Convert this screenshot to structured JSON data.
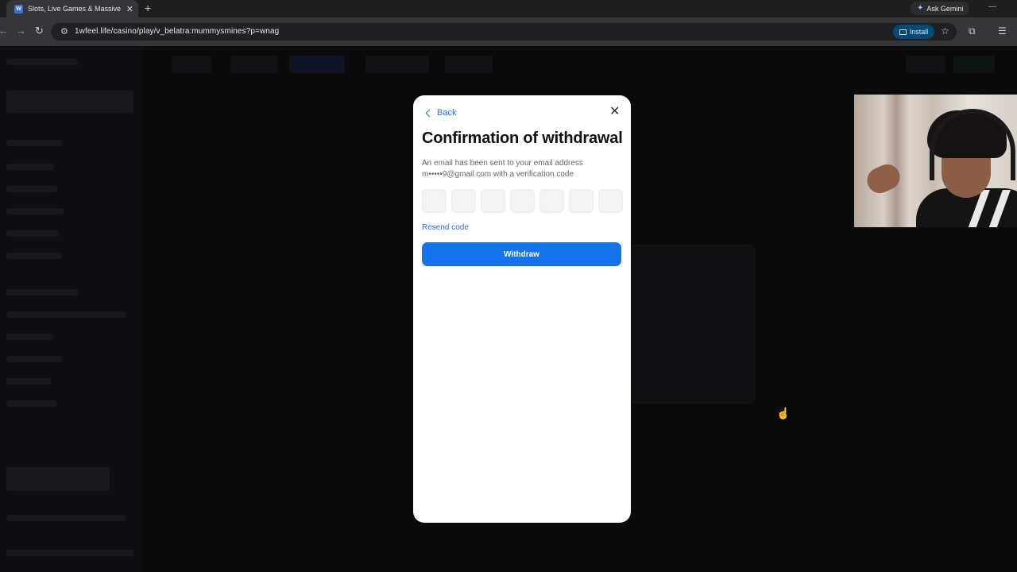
{
  "browser": {
    "tab_title": "Slots, Live Games & Massive Ja",
    "tab_favicon": "W",
    "new_tab": "+",
    "gemini_label": "Ask Gemini",
    "url": "1wfeel.life/casino/play/v_belatra:mummysmines?p=wnag",
    "install_label": "Install"
  },
  "modal": {
    "back_label": "Back",
    "title": "Confirmation of withdrawal",
    "description": "An email has been sent to your email address m•••••9@gmail.com with a verification code",
    "code_length": 7,
    "resend_label": "Resend code",
    "submit_label": "Withdraw"
  },
  "icons": {
    "back": "chevron-left-icon",
    "close": "close-icon",
    "star": "star-icon",
    "extensions": "puzzle-icon",
    "menu": "menu-icon"
  },
  "colors": {
    "accent": "#1273eb",
    "link": "#2b6de0",
    "code_box": "#f2f3f5"
  }
}
